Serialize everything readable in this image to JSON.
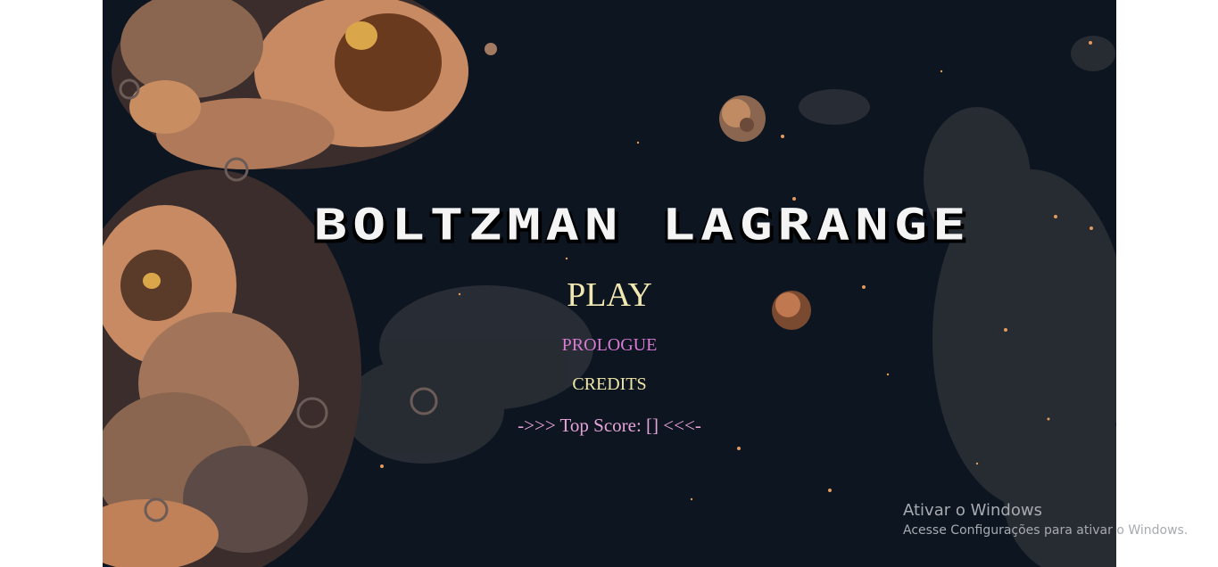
{
  "game": {
    "title": "BOLTZMAN LAGRANGE",
    "menu": {
      "play": "PLAY",
      "prologue": "PROLOGUE",
      "credits": "CREDITS"
    },
    "top_score_text": "->>> Top Score: [] <<<-"
  },
  "watermark": {
    "title": "Ativar o Windows",
    "subtitle": "Acesse Configurações para ativar o Windows."
  },
  "colors": {
    "space_background": "#0c1520",
    "nebula_light": "#c78a62",
    "nebula_dark": "#3a2a28",
    "play": "#f1e7b0",
    "prologue": "#d77bd3",
    "credits": "#efe6a8",
    "top_score": "#e6a3d8",
    "title": "#f4f4f4"
  }
}
